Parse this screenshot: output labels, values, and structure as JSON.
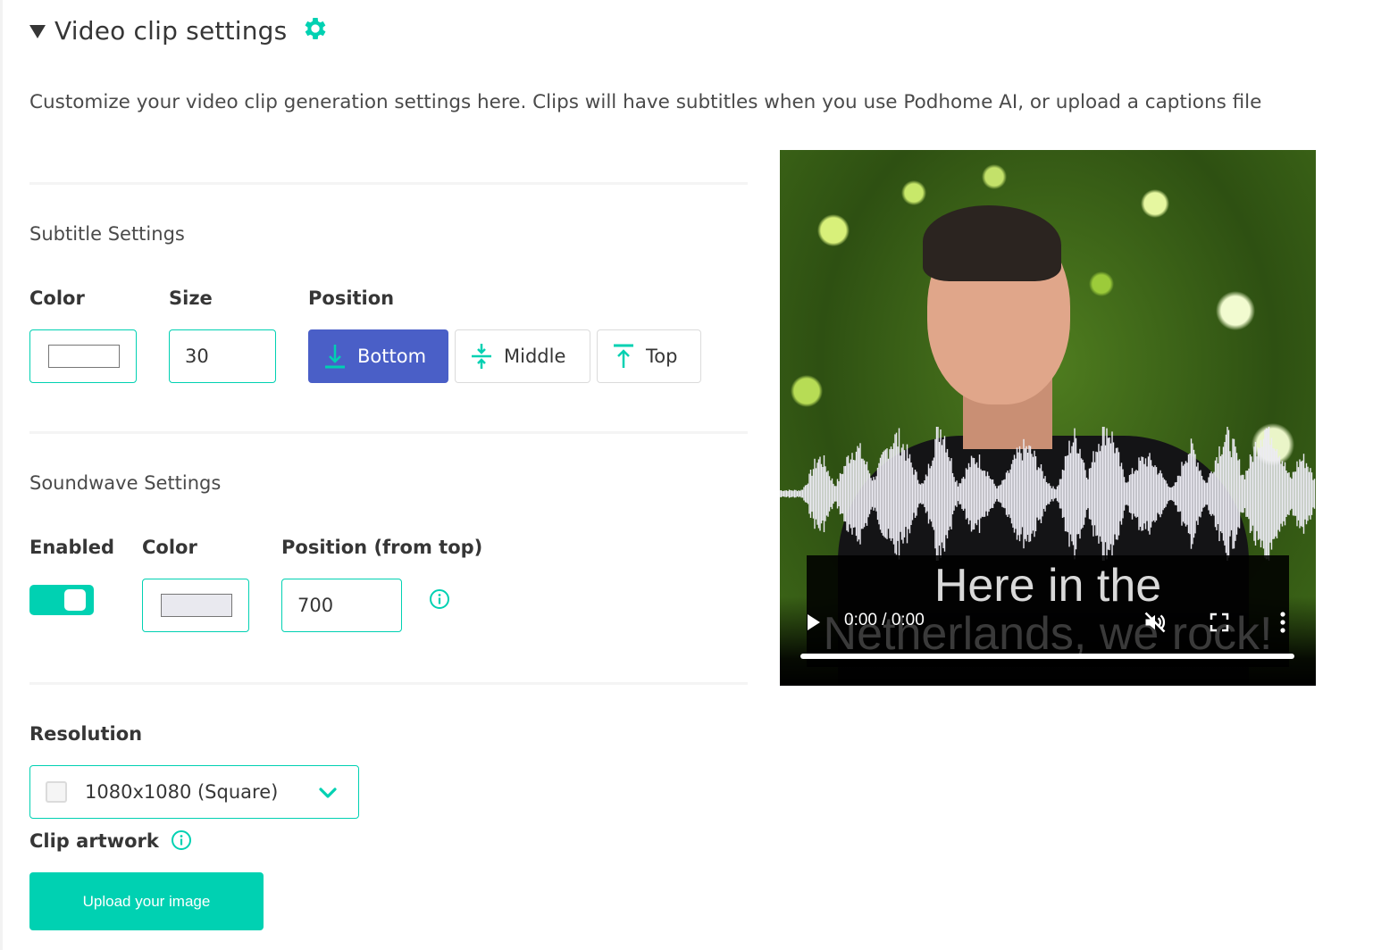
{
  "header": {
    "title": "Video clip settings",
    "expanded": true,
    "gear_icon": "gear-icon"
  },
  "description": "Customize your video clip generation settings here. Clips will have subtitles when you use Podhome AI, or upload a captions file",
  "colors": {
    "accent": "#00d1b2",
    "primary": "#4a5fc7",
    "text": "#363636"
  },
  "subtitle_settings": {
    "title": "Subtitle Settings",
    "color_label": "Color",
    "color_value": "#ffffff",
    "size_label": "Size",
    "size_value": "30",
    "position_label": "Position",
    "positions": [
      {
        "label": "Bottom",
        "icon": "align-bottom-icon",
        "active": true
      },
      {
        "label": "Middle",
        "icon": "align-middle-icon",
        "active": false
      },
      {
        "label": "Top",
        "icon": "align-top-icon",
        "active": false
      }
    ]
  },
  "soundwave_settings": {
    "title": "Soundwave Settings",
    "enabled_label": "Enabled",
    "enabled": true,
    "color_label": "Color",
    "color_value": "#e9e9ef",
    "position_label": "Position (from top)",
    "position_value": "700",
    "info_icon": "info-icon"
  },
  "resolution": {
    "label": "Resolution",
    "selected": "1080x1080 (Square)"
  },
  "clip_artwork": {
    "label": "Clip artwork",
    "info_icon": "info-icon",
    "upload_label": "Upload your image"
  },
  "preview": {
    "subtitle_line1": "Here in the",
    "subtitle_line2": "Netherlands, we rock!",
    "time": "0:00 / 0:00",
    "muted": true,
    "progress": 0
  }
}
